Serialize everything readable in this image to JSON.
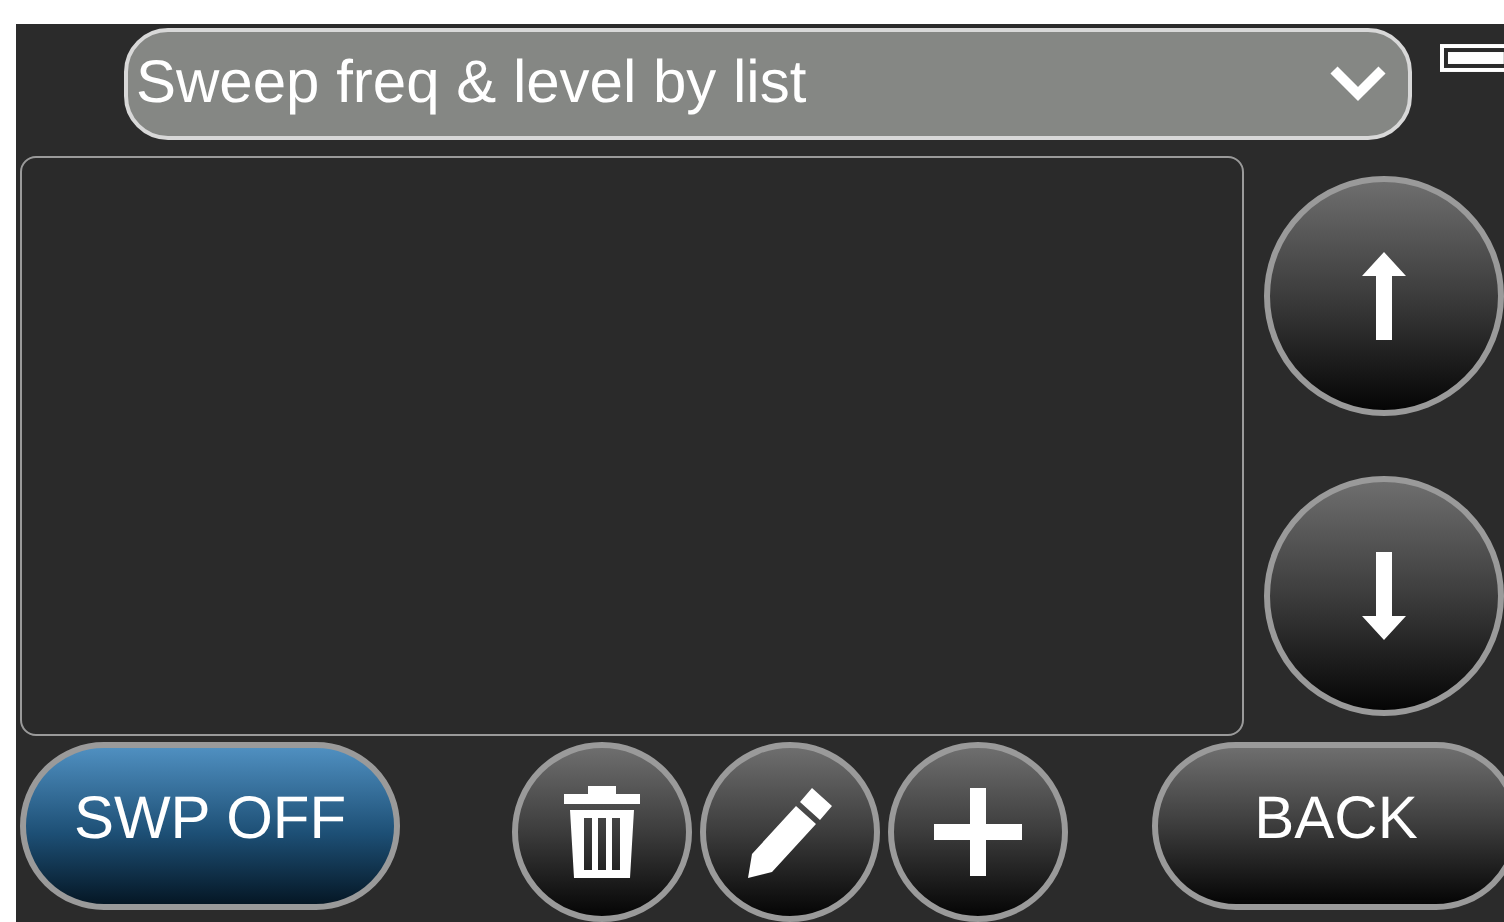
{
  "mode_select": {
    "value": "Sweep freq & level by list"
  },
  "list_panel": {
    "kind": "empty"
  },
  "scroll_buttons": [
    {
      "kind": "up"
    },
    {
      "kind": "down"
    }
  ],
  "bottom_bar": {
    "sweep_button": {
      "label": "SWP OFF",
      "on": false
    },
    "actions": [
      {
        "kind": "delete"
      },
      {
        "kind": "edit"
      },
      {
        "kind": "add"
      }
    ],
    "back_button": {
      "label": "BACK"
    }
  }
}
